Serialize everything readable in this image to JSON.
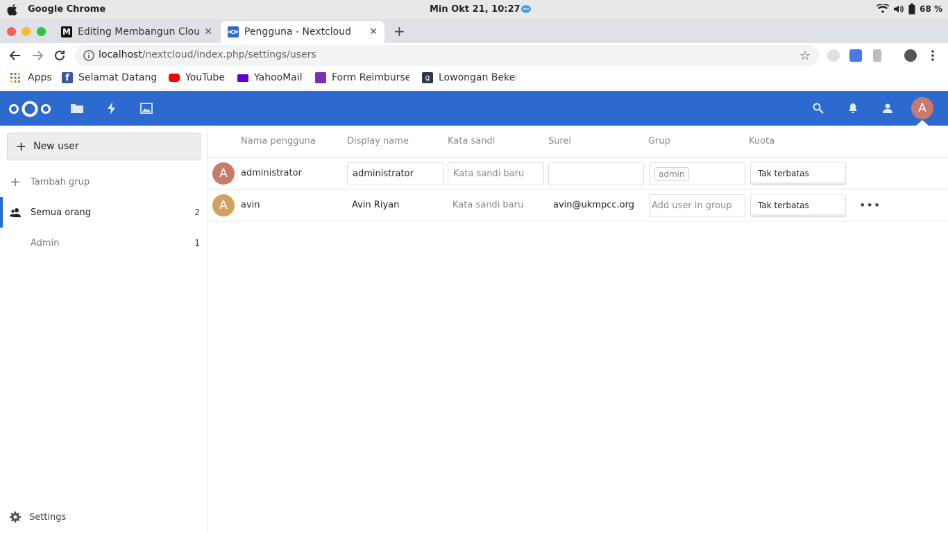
{
  "os": {
    "app_name": "Google Chrome",
    "clock": "Min Okt 21, 10:27",
    "battery": "68 %"
  },
  "tabs": [
    {
      "title": "Editing Membangun Clou",
      "icon": "M"
    },
    {
      "title": "Pengguna - Nextcloud",
      "icon": "nc"
    }
  ],
  "address": {
    "host": "localhost",
    "path": "/nextcloud/index.php/settings/users"
  },
  "bookmarks": [
    {
      "label": "Apps"
    },
    {
      "label": "Selamat Datang"
    },
    {
      "label": "YouTube"
    },
    {
      "label": "YahooMail"
    },
    {
      "label": "Form Reimburse"
    },
    {
      "label": "Lowongan Beker"
    }
  ],
  "header": {
    "avatar_letter": "A"
  },
  "sidebar": {
    "new_user_label": "New user",
    "add_group_label": "Tambah grup",
    "groups": [
      {
        "label": "Semua orang",
        "count": "2"
      },
      {
        "label": "Admin",
        "count": "1"
      }
    ],
    "settings_label": "Settings"
  },
  "table": {
    "columns": [
      "Nama pengguna",
      "Display name",
      "Kata sandi",
      "Surel",
      "Grup",
      "Kuota"
    ],
    "rows": [
      {
        "avatar": "A",
        "username": "administrator",
        "display_name": "administrator",
        "password_placeholder": "Kata sandi baru",
        "email": "",
        "group_chip": "admin",
        "quota": "Tak terbatas"
      },
      {
        "avatar": "A",
        "username": "avin",
        "display_name": "Avin Riyan",
        "password_placeholder": "Kata sandi baru",
        "email": "avin@ukmpcc.org",
        "group_placeholder": "Add user in group",
        "quota": "Tak terbatas",
        "more": "•••"
      }
    ]
  },
  "colors": {
    "nextcloud_blue": "#2d6acf",
    "avatar_admin": "#c97a6a",
    "avatar_avin": "#d3a05f"
  }
}
